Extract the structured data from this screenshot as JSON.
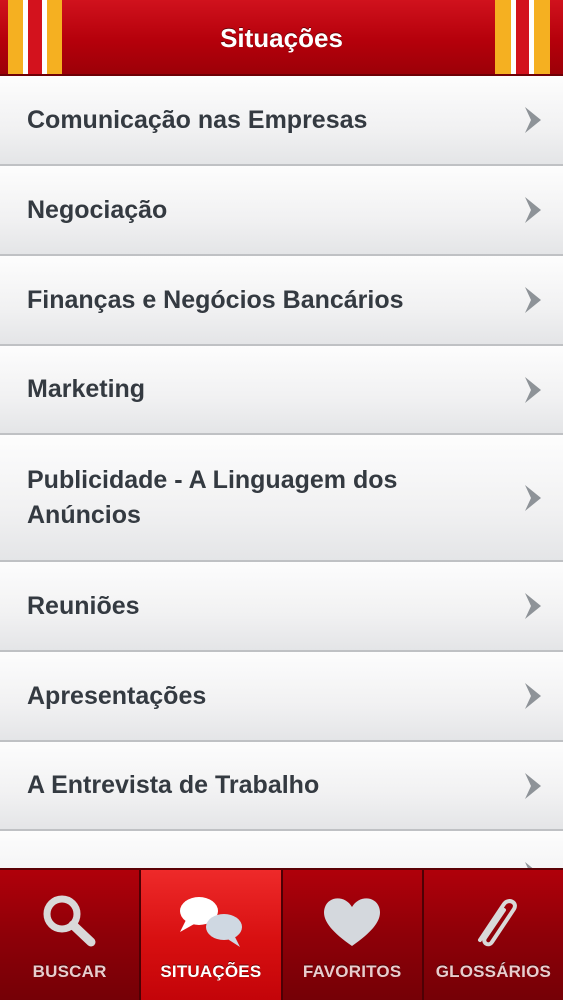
{
  "header": {
    "title": "Situações",
    "stripe_colors": [
      "#f5b021",
      "#ffffff",
      "#d3121d"
    ]
  },
  "list": {
    "items": [
      {
        "label": "Comunicação nas Empresas"
      },
      {
        "label": "Negociação"
      },
      {
        "label": "Finanças e Negócios Bancários"
      },
      {
        "label": "Marketing"
      },
      {
        "label": "Publicidade - A Linguagem dos Anúncios"
      },
      {
        "label": "Reuniões"
      },
      {
        "label": "Apresentações"
      },
      {
        "label": "A Entrevista de Trabalho"
      },
      {
        "label": ""
      }
    ]
  },
  "tabbar": {
    "active": "situacoes",
    "tabs": [
      {
        "id": "buscar",
        "label": "BUSCAR",
        "icon": "magnifier-icon"
      },
      {
        "id": "situacoes",
        "label": "SITUAÇÕES",
        "icon": "speech-bubbles-icon"
      },
      {
        "id": "favoritos",
        "label": "FAVORITOS",
        "icon": "heart-icon"
      },
      {
        "id": "glossarios",
        "label": "GLOSSÁRIOS",
        "icon": "paperclip-icon"
      }
    ]
  },
  "colors": {
    "header_red": "#b5000b",
    "stripe_yellow": "#f5b021",
    "tab_active_red": "#d70f10",
    "text_dark": "#343a41",
    "chevron_gray": "#8e9398"
  }
}
